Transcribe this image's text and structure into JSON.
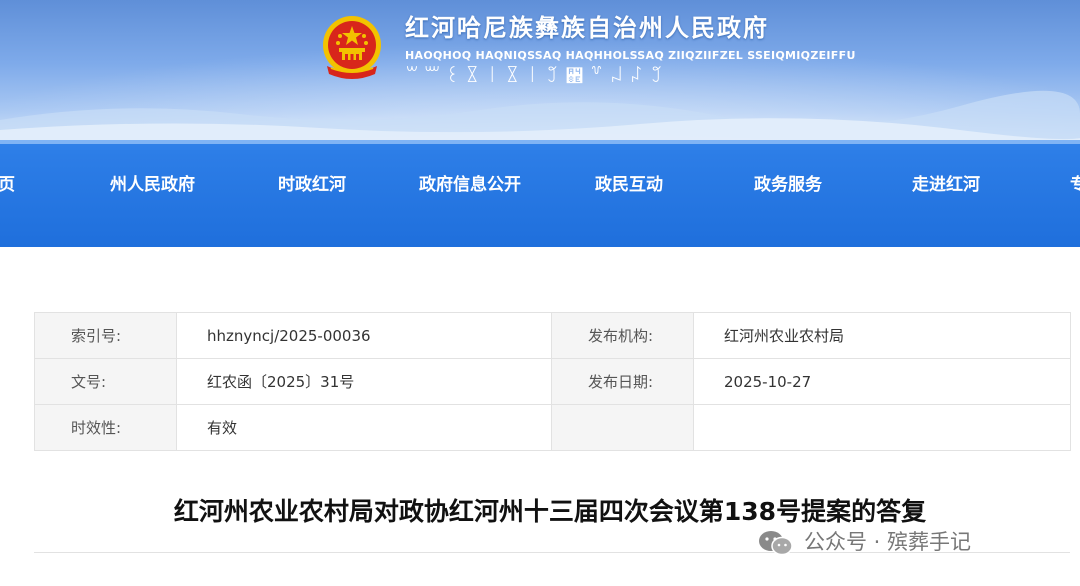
{
  "header": {
    "title": "红河哈尼族彝族自治州人民政府",
    "subtitle": "HAOQHOQ HAQNIQSSAQ HAQHHOLSSAQ ZIIQZIIFZEL SSEIQMIQZEIFFU",
    "script_line": "꒳꒶꒰꒾꒐꒾꒐꒸꒎꒷꒖꒗꒸",
    "emblem_icon": "national-emblem-icon"
  },
  "nav": {
    "items": [
      {
        "label": "页"
      },
      {
        "label": "州人民政府"
      },
      {
        "label": "时政红河"
      },
      {
        "label": "政府信息公开"
      },
      {
        "label": "政民互动"
      },
      {
        "label": "政务服务"
      },
      {
        "label": "走进红河"
      },
      {
        "label": "专"
      }
    ]
  },
  "meta": {
    "index_label": "索引号:",
    "index_value": "hhznyncj/2025-00036",
    "org_label": "发布机构:",
    "org_value": "红河州农业农村局",
    "doc_no_label": "文号:",
    "doc_no_value": "红农函〔2025〕31号",
    "date_label": "发布日期:",
    "date_value": "2025-10-27",
    "validity_label": "时效性:",
    "validity_value": "有效"
  },
  "article": {
    "title": "红河州农业农村局对政协红河州十三届四次会议第138号提案的答复"
  },
  "watermark": {
    "text": "公众号 · 殡葬手记",
    "icon": "wechat-icon"
  },
  "colors": {
    "nav_bg": "#1f6fdc",
    "banner_top": "#5f8fd8",
    "emblem_red": "#d8261b",
    "emblem_gold": "#f3c200"
  }
}
